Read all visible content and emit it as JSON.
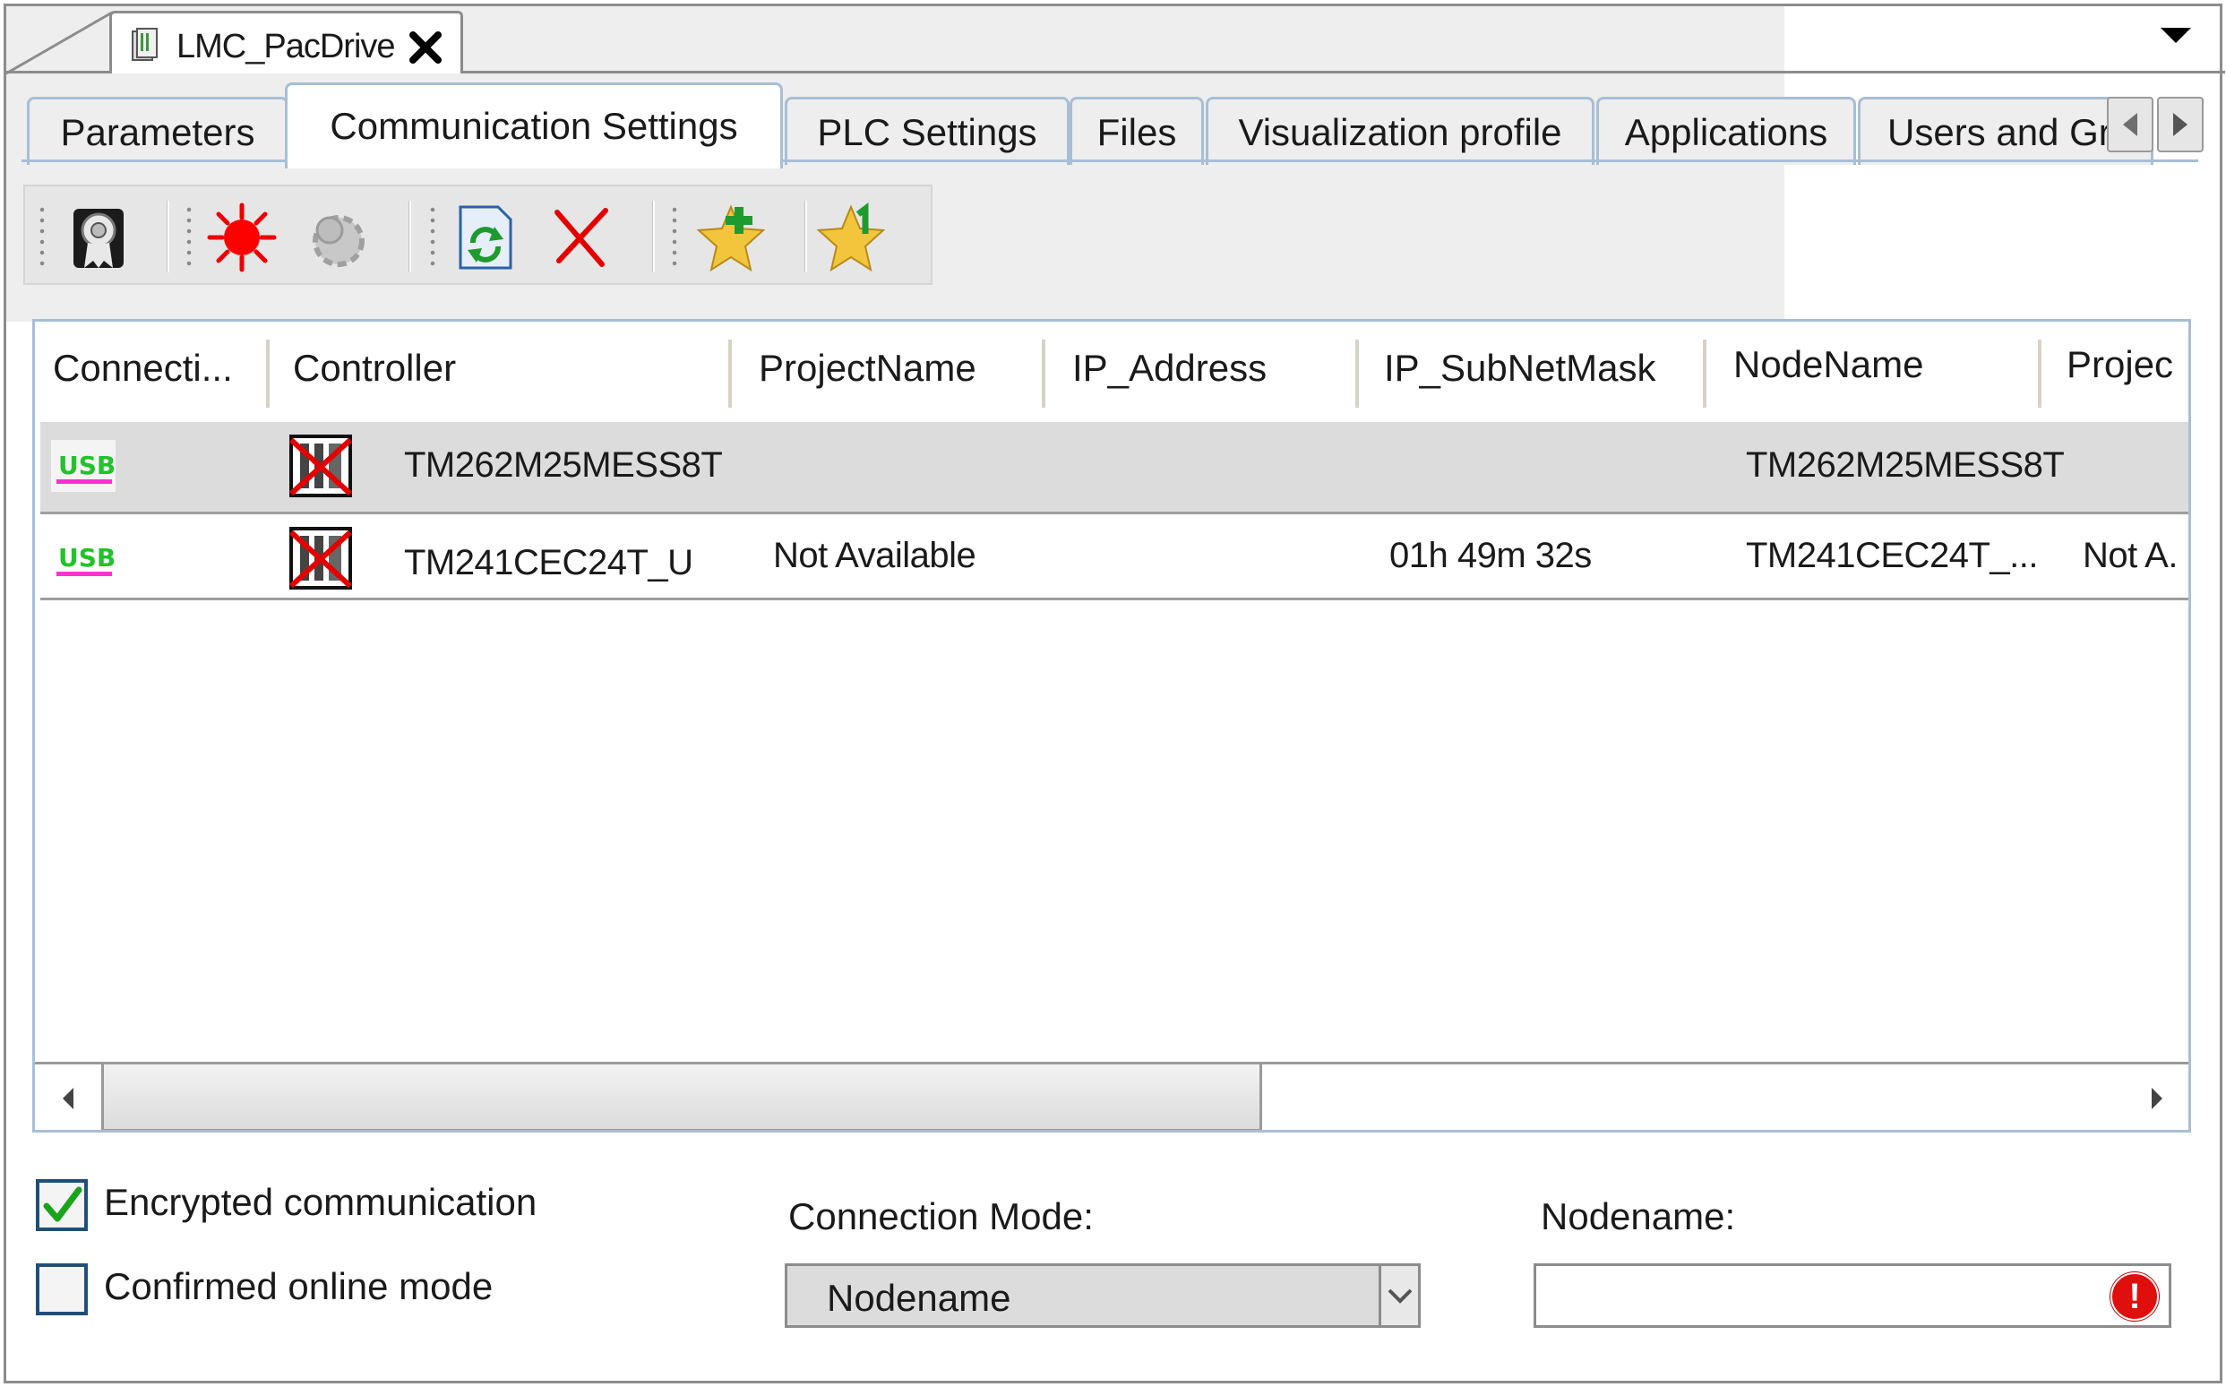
{
  "document_tab": {
    "title": "LMC_PacDrive"
  },
  "tabs": [
    {
      "label": "Parameters"
    },
    {
      "label": "Communication Settings",
      "active": true
    },
    {
      "label": "PLC Settings"
    },
    {
      "label": "Files"
    },
    {
      "label": "Visualization profile"
    },
    {
      "label": "Applications"
    },
    {
      "label": "Users and Gr"
    }
  ],
  "toolbar": {
    "icons": [
      "certificate-icon",
      "flash-icon",
      "gear-icon",
      "refresh-icon",
      "delete-icon",
      "add-favorite-icon",
      "favorite-list-icon"
    ]
  },
  "grid": {
    "columns": [
      "Connecti...",
      "Controller",
      "ProjectName",
      "IP_Address",
      "IP_SubNetMask",
      "NodeName",
      "Projec"
    ],
    "rows": [
      {
        "connection": "USB",
        "controller": "TM262M25MESS8T",
        "project_name": "",
        "ip_address": "",
        "ip_subnet_mask": "",
        "node_name": "TM262M25MESS8T",
        "project": "",
        "selected": true
      },
      {
        "connection": "USB",
        "controller": "TM241CEC24T_U",
        "project_name": "Not Available",
        "ip_address": "",
        "ip_subnet_mask": "01h 49m 32s",
        "node_name": "TM241CEC24T_...",
        "project": "Not A.",
        "selected": false
      }
    ]
  },
  "options": {
    "encrypted_label": "Encrypted communication",
    "encrypted_checked": true,
    "confirmed_label": "Confirmed online mode",
    "confirmed_checked": false
  },
  "connection_mode": {
    "label": "Connection Mode:",
    "value": "Nodename"
  },
  "nodename": {
    "label": "Nodename:",
    "value": ""
  },
  "colors": {
    "tab_border": "#a7bfd6",
    "selected_row": "#dcdcdc",
    "usb_green": "#22c32a",
    "usb_magenta": "#ff2fd6",
    "error_red": "#e10e0e",
    "check_green": "#1aa31a"
  }
}
